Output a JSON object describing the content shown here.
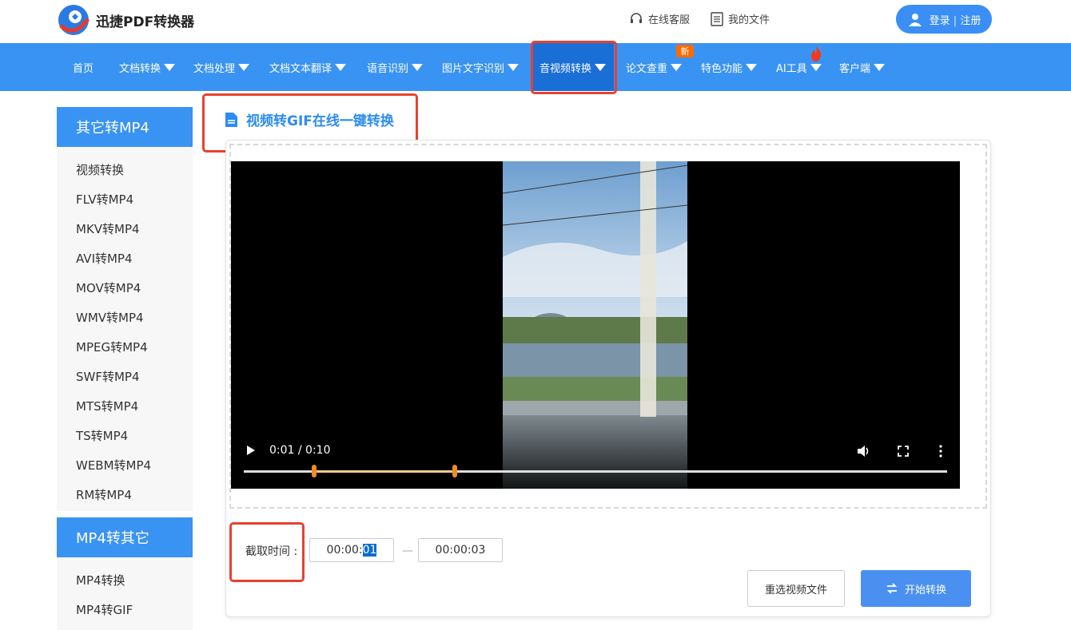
{
  "header": {
    "app_name": "迅捷PDF转换器",
    "service_label": "在线客服",
    "files_label": "我的文件",
    "login_label": "登录",
    "register_label": "注册"
  },
  "nav": {
    "items": [
      {
        "label": "首页"
      },
      {
        "label": "文档转换"
      },
      {
        "label": "文档处理"
      },
      {
        "label": "文档文本翻译"
      },
      {
        "label": "语音识别"
      },
      {
        "label": "图片文字识别"
      },
      {
        "label": "音视频转换"
      },
      {
        "label": "论文查重"
      },
      {
        "label": "特色功能"
      },
      {
        "label": "AI工具"
      },
      {
        "label": "客户端"
      }
    ],
    "new_badge": "新"
  },
  "sidebar": {
    "group1_title": "其它转MP4",
    "group1_items": [
      "视频转换",
      "FLV转MP4",
      "MKV转MP4",
      "AVI转MP4",
      "MOV转MP4",
      "WMV转MP4",
      "MPEG转MP4",
      "SWF转MP4",
      "MTS转MP4",
      "TS转MP4",
      "WEBM转MP4",
      "RM转MP4"
    ],
    "group2_title": "MP4转其它",
    "group2_items": [
      "MP4转换",
      "MP4转GIF"
    ]
  },
  "main": {
    "title": "视频转GIF在线一键转换",
    "player_time": "0:01 / 0:10",
    "trim_start_fraction": 0.1,
    "trim_end_fraction": 0.3,
    "capture_label": "截取时间 :",
    "start_time_prefix": "00:00:",
    "start_time_selected": "01",
    "end_time": "00:00:03",
    "range_sep": "—",
    "reselect_label": "重选视频文件",
    "start_label": "开始转换"
  },
  "colors": {
    "nav_bg": "#3993f3",
    "nav_active": "#1a6fd6",
    "highlight_box": "#e8412f",
    "accent": "#2d8cf0"
  }
}
